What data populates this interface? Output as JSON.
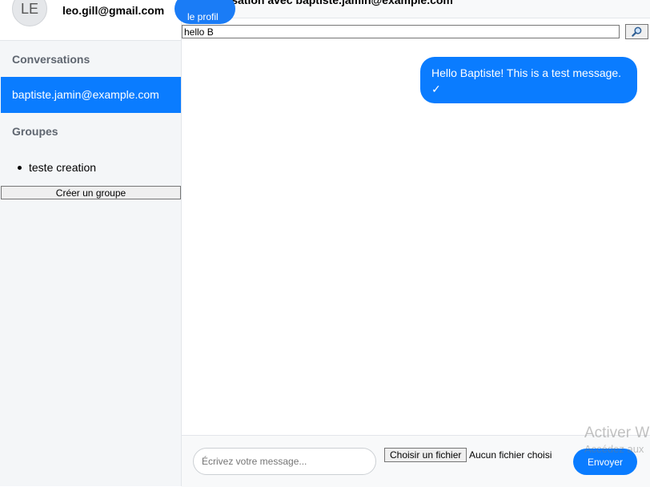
{
  "profile": {
    "avatar_initials": "LE",
    "email": "leo.gill@gmail.com",
    "profile_button_label": "le profil"
  },
  "sidebar": {
    "conversations_title": "Conversations",
    "conversations": [
      {
        "label": "baptiste.jamin@example.com",
        "active": true
      }
    ],
    "groups_title": "Groupes",
    "groups": [
      {
        "label": "teste creation"
      }
    ],
    "create_group_label": "Créer un groupe"
  },
  "chat": {
    "title": "Conversation avec baptiste.jamin@example.com",
    "search_value": "hello B",
    "search_icon": "magnifier-icon",
    "messages": [
      {
        "text": "Hello Baptiste! This is a test message.",
        "status": "✓",
        "sent": true
      }
    ]
  },
  "composer": {
    "placeholder": "Écrivez votre message...",
    "file_button_label": "Choisir un fichier",
    "file_status": "Aucun fichier choisi",
    "send_label": "Envoyer"
  },
  "watermark": {
    "line1": "Activer W",
    "line2": "Accédez aux"
  },
  "colors": {
    "accent": "#0a7cff",
    "sidebar_bg": "#f4f6f8"
  }
}
